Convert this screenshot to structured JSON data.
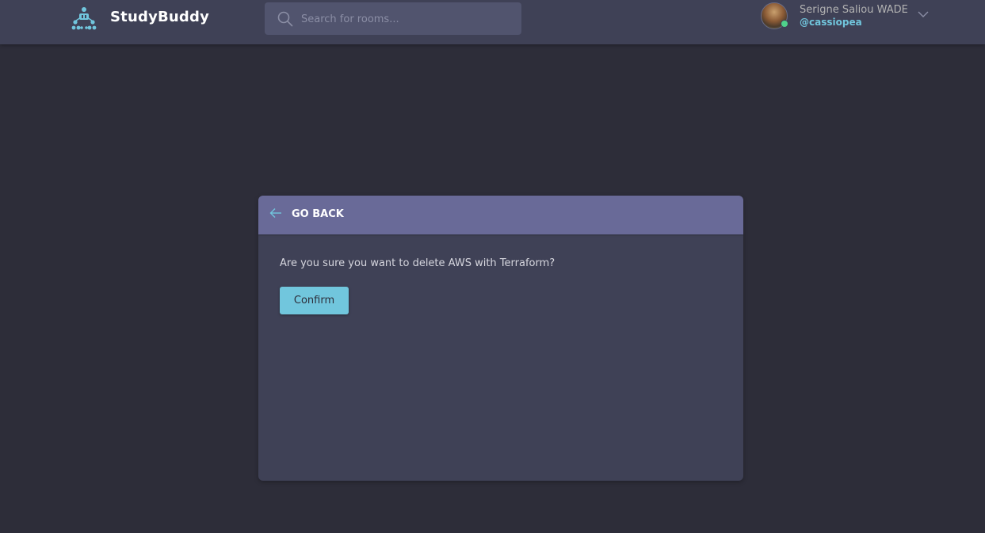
{
  "header": {
    "logo_icon": "team-network-icon",
    "brand": "StudyBuddy",
    "search": {
      "icon": "search-icon",
      "placeholder": "Search for rooms...",
      "value": ""
    },
    "user": {
      "name": "Serigne Saliou WADE",
      "handle": "@cassiopea",
      "status": "online",
      "menu_icon": "chevron-down-icon"
    }
  },
  "dialog": {
    "back_icon": "arrow-left-icon",
    "back_label": "GO BACK",
    "message": "Are you sure you want to delete AWS with Terraform?",
    "confirm_label": "Confirm"
  },
  "colors": {
    "background": "#2d2d39",
    "header": "#3f4156",
    "card_header": "#696a98",
    "accent": "#71c6dd",
    "online": "#4fd18b"
  }
}
